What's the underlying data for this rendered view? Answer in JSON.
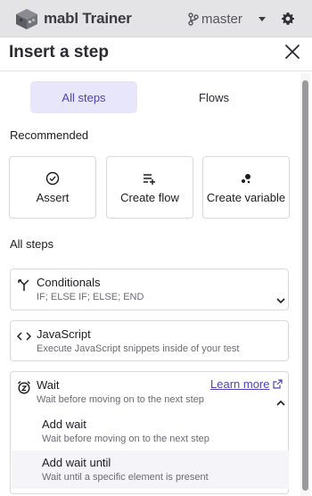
{
  "app": {
    "title": "mabl Trainer",
    "branch": "master"
  },
  "panel": {
    "title": "Insert a step"
  },
  "tabs": [
    {
      "label": "All steps",
      "active": true
    },
    {
      "label": "Flows",
      "active": false
    }
  ],
  "recommended": {
    "heading": "Recommended",
    "items": [
      {
        "label": "Assert",
        "icon": "check-circle-icon"
      },
      {
        "label": "Create flow",
        "icon": "list-add-icon"
      },
      {
        "label": "Create variable",
        "icon": "variable-icon"
      }
    ]
  },
  "all_steps": {
    "heading": "All steps",
    "items": [
      {
        "name": "Conditionals",
        "description": "IF; ELSE IF; ELSE; END",
        "icon": "branch-fork-icon",
        "expanded": false
      },
      {
        "name": "JavaScript",
        "description": "Execute JavaScript snippets inside of your test",
        "icon": "code-icon"
      },
      {
        "name": "Wait",
        "description": "Wait before moving on to the next step",
        "icon": "alarm-clock-icon",
        "expanded": true,
        "learn_more": "Learn more",
        "sub_items": [
          {
            "name": "Add wait",
            "description": "Wait before moving on to the next step"
          },
          {
            "name": "Add wait until",
            "description": "Wait until a specific element is present"
          }
        ]
      }
    ]
  },
  "colors": {
    "accent": "#4d43b8",
    "tab_active_bg": "#e8e6fb",
    "topbar_bg": "#e4e4e6"
  }
}
